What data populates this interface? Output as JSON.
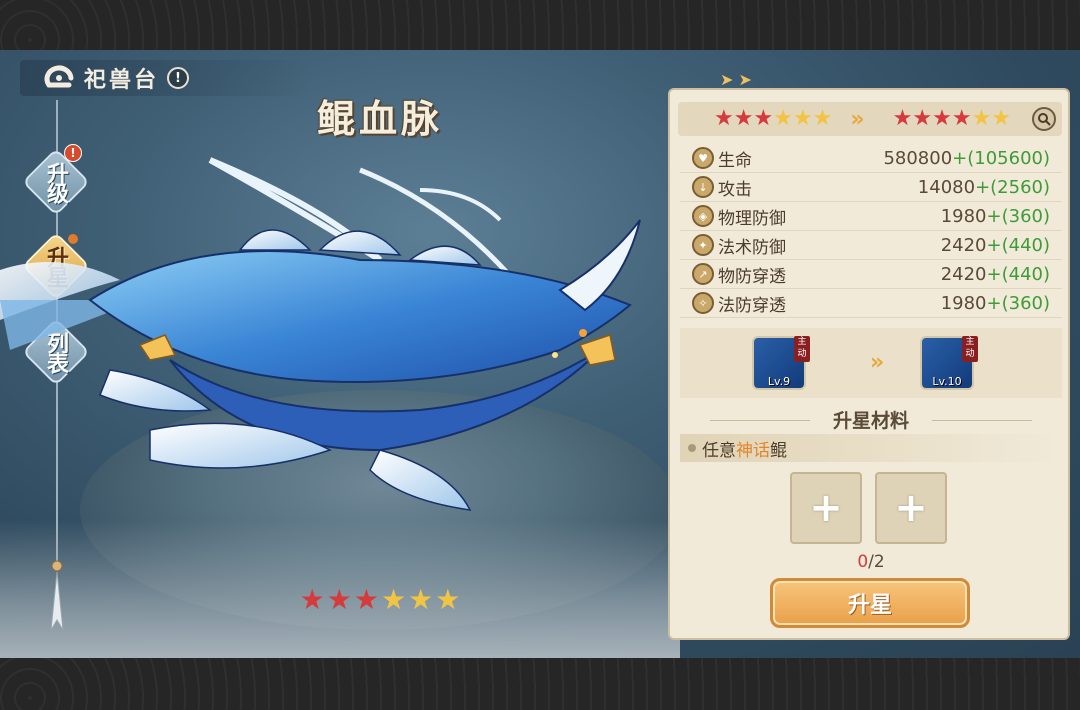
{
  "header": {
    "title": "祀兽台",
    "info_icon": "!"
  },
  "beast": {
    "name": "鲲血脉",
    "stage_stars": {
      "filled": 3,
      "total": 6
    }
  },
  "nav": {
    "items": [
      {
        "label": "升级",
        "active": false,
        "alert": "!"
      },
      {
        "label": "升星",
        "active": true,
        "dot": true
      },
      {
        "label": "列表",
        "active": false
      }
    ]
  },
  "panel": {
    "stars_from": {
      "filled": 3,
      "total": 6
    },
    "stars_to": {
      "filled": 4,
      "total": 6
    },
    "stats": [
      {
        "name": "生命",
        "base": "580800",
        "bonus": "+(105600)",
        "icon": "heart-icon"
      },
      {
        "name": "攻击",
        "base": "14080",
        "bonus": "+(2560)",
        "icon": "sword-icon"
      },
      {
        "name": "物理防御",
        "base": "1980",
        "bonus": "+(360)",
        "icon": "shield-icon"
      },
      {
        "name": "法术防御",
        "base": "2420",
        "bonus": "+(440)",
        "icon": "magic-shield-icon"
      },
      {
        "name": "物防穿透",
        "base": "2420",
        "bonus": "+(440)",
        "icon": "pierce-icon"
      },
      {
        "name": "法防穿透",
        "base": "1980",
        "bonus": "+(360)",
        "icon": "magic-pierce-icon"
      }
    ],
    "skill_from": {
      "level": "Lv.9",
      "tag": "主动"
    },
    "skill_to": {
      "level": "Lv.10",
      "tag": "主动"
    },
    "materials_title": "升星材料",
    "requirement": {
      "prefix": "任意",
      "highlight": "神话",
      "suffix": "鲲"
    },
    "slots": [
      "+",
      "+"
    ],
    "progress": {
      "current": "0",
      "sep_total": "/2"
    },
    "upgrade_label": "升星"
  },
  "colors": {
    "star_filled": "#d63a3c",
    "star_empty": "#f2c444",
    "bonus_green": "#3f9b37",
    "accent_gold": "#e9a04a"
  }
}
